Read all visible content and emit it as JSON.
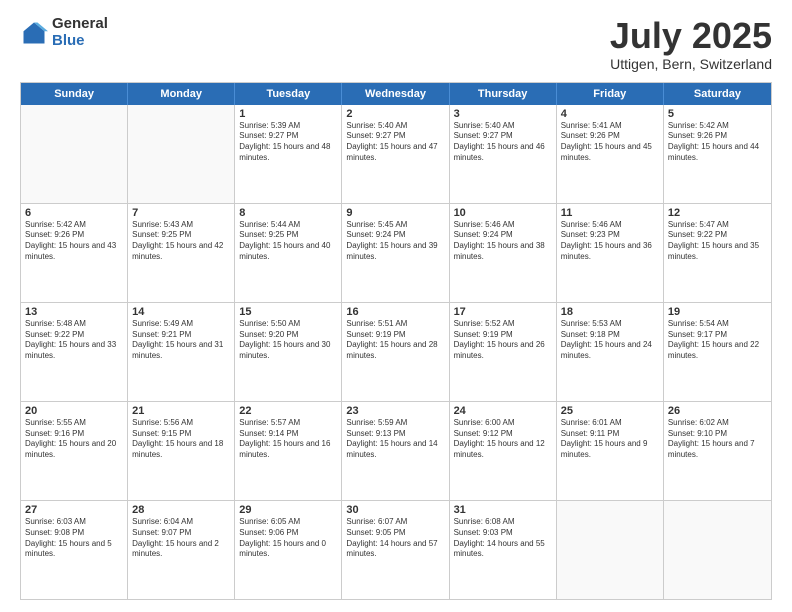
{
  "logo": {
    "general": "General",
    "blue": "Blue"
  },
  "title": "July 2025",
  "subtitle": "Uttigen, Bern, Switzerland",
  "headers": [
    "Sunday",
    "Monday",
    "Tuesday",
    "Wednesday",
    "Thursday",
    "Friday",
    "Saturday"
  ],
  "weeks": [
    [
      {
        "day": "",
        "sunrise": "",
        "sunset": "",
        "daylight": ""
      },
      {
        "day": "",
        "sunrise": "",
        "sunset": "",
        "daylight": ""
      },
      {
        "day": "1",
        "sunrise": "Sunrise: 5:39 AM",
        "sunset": "Sunset: 9:27 PM",
        "daylight": "Daylight: 15 hours and 48 minutes."
      },
      {
        "day": "2",
        "sunrise": "Sunrise: 5:40 AM",
        "sunset": "Sunset: 9:27 PM",
        "daylight": "Daylight: 15 hours and 47 minutes."
      },
      {
        "day": "3",
        "sunrise": "Sunrise: 5:40 AM",
        "sunset": "Sunset: 9:27 PM",
        "daylight": "Daylight: 15 hours and 46 minutes."
      },
      {
        "day": "4",
        "sunrise": "Sunrise: 5:41 AM",
        "sunset": "Sunset: 9:26 PM",
        "daylight": "Daylight: 15 hours and 45 minutes."
      },
      {
        "day": "5",
        "sunrise": "Sunrise: 5:42 AM",
        "sunset": "Sunset: 9:26 PM",
        "daylight": "Daylight: 15 hours and 44 minutes."
      }
    ],
    [
      {
        "day": "6",
        "sunrise": "Sunrise: 5:42 AM",
        "sunset": "Sunset: 9:26 PM",
        "daylight": "Daylight: 15 hours and 43 minutes."
      },
      {
        "day": "7",
        "sunrise": "Sunrise: 5:43 AM",
        "sunset": "Sunset: 9:25 PM",
        "daylight": "Daylight: 15 hours and 42 minutes."
      },
      {
        "day": "8",
        "sunrise": "Sunrise: 5:44 AM",
        "sunset": "Sunset: 9:25 PM",
        "daylight": "Daylight: 15 hours and 40 minutes."
      },
      {
        "day": "9",
        "sunrise": "Sunrise: 5:45 AM",
        "sunset": "Sunset: 9:24 PM",
        "daylight": "Daylight: 15 hours and 39 minutes."
      },
      {
        "day": "10",
        "sunrise": "Sunrise: 5:46 AM",
        "sunset": "Sunset: 9:24 PM",
        "daylight": "Daylight: 15 hours and 38 minutes."
      },
      {
        "day": "11",
        "sunrise": "Sunrise: 5:46 AM",
        "sunset": "Sunset: 9:23 PM",
        "daylight": "Daylight: 15 hours and 36 minutes."
      },
      {
        "day": "12",
        "sunrise": "Sunrise: 5:47 AM",
        "sunset": "Sunset: 9:22 PM",
        "daylight": "Daylight: 15 hours and 35 minutes."
      }
    ],
    [
      {
        "day": "13",
        "sunrise": "Sunrise: 5:48 AM",
        "sunset": "Sunset: 9:22 PM",
        "daylight": "Daylight: 15 hours and 33 minutes."
      },
      {
        "day": "14",
        "sunrise": "Sunrise: 5:49 AM",
        "sunset": "Sunset: 9:21 PM",
        "daylight": "Daylight: 15 hours and 31 minutes."
      },
      {
        "day": "15",
        "sunrise": "Sunrise: 5:50 AM",
        "sunset": "Sunset: 9:20 PM",
        "daylight": "Daylight: 15 hours and 30 minutes."
      },
      {
        "day": "16",
        "sunrise": "Sunrise: 5:51 AM",
        "sunset": "Sunset: 9:19 PM",
        "daylight": "Daylight: 15 hours and 28 minutes."
      },
      {
        "day": "17",
        "sunrise": "Sunrise: 5:52 AM",
        "sunset": "Sunset: 9:19 PM",
        "daylight": "Daylight: 15 hours and 26 minutes."
      },
      {
        "day": "18",
        "sunrise": "Sunrise: 5:53 AM",
        "sunset": "Sunset: 9:18 PM",
        "daylight": "Daylight: 15 hours and 24 minutes."
      },
      {
        "day": "19",
        "sunrise": "Sunrise: 5:54 AM",
        "sunset": "Sunset: 9:17 PM",
        "daylight": "Daylight: 15 hours and 22 minutes."
      }
    ],
    [
      {
        "day": "20",
        "sunrise": "Sunrise: 5:55 AM",
        "sunset": "Sunset: 9:16 PM",
        "daylight": "Daylight: 15 hours and 20 minutes."
      },
      {
        "day": "21",
        "sunrise": "Sunrise: 5:56 AM",
        "sunset": "Sunset: 9:15 PM",
        "daylight": "Daylight: 15 hours and 18 minutes."
      },
      {
        "day": "22",
        "sunrise": "Sunrise: 5:57 AM",
        "sunset": "Sunset: 9:14 PM",
        "daylight": "Daylight: 15 hours and 16 minutes."
      },
      {
        "day": "23",
        "sunrise": "Sunrise: 5:59 AM",
        "sunset": "Sunset: 9:13 PM",
        "daylight": "Daylight: 15 hours and 14 minutes."
      },
      {
        "day": "24",
        "sunrise": "Sunrise: 6:00 AM",
        "sunset": "Sunset: 9:12 PM",
        "daylight": "Daylight: 15 hours and 12 minutes."
      },
      {
        "day": "25",
        "sunrise": "Sunrise: 6:01 AM",
        "sunset": "Sunset: 9:11 PM",
        "daylight": "Daylight: 15 hours and 9 minutes."
      },
      {
        "day": "26",
        "sunrise": "Sunrise: 6:02 AM",
        "sunset": "Sunset: 9:10 PM",
        "daylight": "Daylight: 15 hours and 7 minutes."
      }
    ],
    [
      {
        "day": "27",
        "sunrise": "Sunrise: 6:03 AM",
        "sunset": "Sunset: 9:08 PM",
        "daylight": "Daylight: 15 hours and 5 minutes."
      },
      {
        "day": "28",
        "sunrise": "Sunrise: 6:04 AM",
        "sunset": "Sunset: 9:07 PM",
        "daylight": "Daylight: 15 hours and 2 minutes."
      },
      {
        "day": "29",
        "sunrise": "Sunrise: 6:05 AM",
        "sunset": "Sunset: 9:06 PM",
        "daylight": "Daylight: 15 hours and 0 minutes."
      },
      {
        "day": "30",
        "sunrise": "Sunrise: 6:07 AM",
        "sunset": "Sunset: 9:05 PM",
        "daylight": "Daylight: 14 hours and 57 minutes."
      },
      {
        "day": "31",
        "sunrise": "Sunrise: 6:08 AM",
        "sunset": "Sunset: 9:03 PM",
        "daylight": "Daylight: 14 hours and 55 minutes."
      },
      {
        "day": "",
        "sunrise": "",
        "sunset": "",
        "daylight": ""
      },
      {
        "day": "",
        "sunrise": "",
        "sunset": "",
        "daylight": ""
      }
    ]
  ]
}
